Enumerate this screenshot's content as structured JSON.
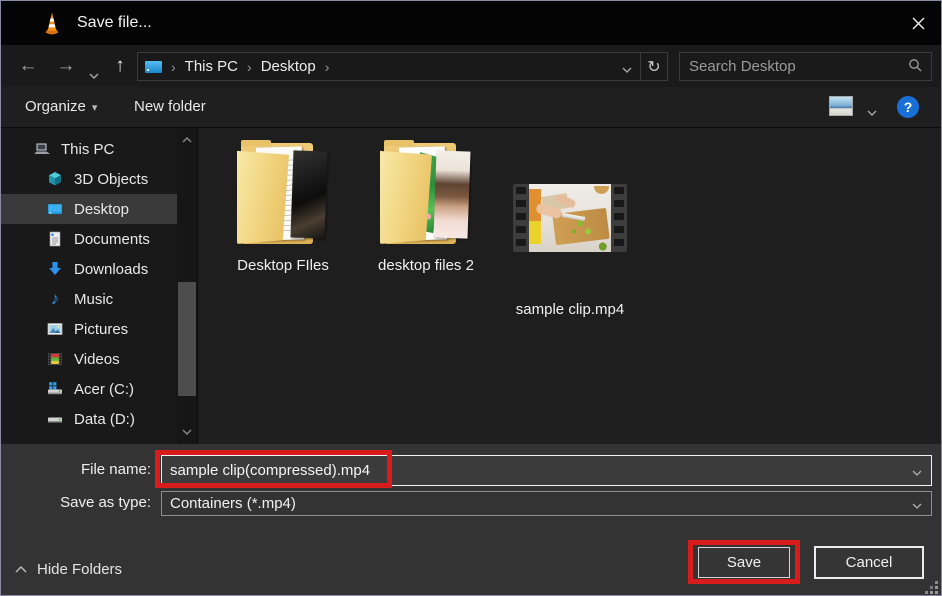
{
  "window": {
    "title": "Save file..."
  },
  "navbar": {
    "back_icon": "←",
    "forward_icon": "→",
    "up_icon": "↑",
    "refresh_icon": "↻",
    "breadcrumb": {
      "separator": "›",
      "items": [
        "This PC",
        "Desktop"
      ]
    },
    "search": {
      "placeholder": "Search Desktop"
    }
  },
  "toolbar": {
    "organize": "Organize",
    "organize_caret": "▾",
    "new_folder": "New folder",
    "help": "?"
  },
  "sidebar": {
    "items": [
      {
        "label": "This PC",
        "icon": "pc-icon",
        "selected": false
      },
      {
        "label": "3D Objects",
        "icon": "cube-icon",
        "selected": false
      },
      {
        "label": "Desktop",
        "icon": "monitor-icon",
        "selected": true
      },
      {
        "label": "Documents",
        "icon": "document-icon",
        "selected": false
      },
      {
        "label": "Downloads",
        "icon": "download-icon",
        "selected": false
      },
      {
        "label": "Music",
        "icon": "music-note-icon",
        "selected": false
      },
      {
        "label": "Pictures",
        "icon": "picture-icon",
        "selected": false
      },
      {
        "label": "Videos",
        "icon": "film-icon",
        "selected": false
      },
      {
        "label": "Acer (C:)",
        "icon": "drive-windows-icon",
        "selected": false
      },
      {
        "label": "Data (D:)",
        "icon": "drive-icon",
        "selected": false
      }
    ],
    "music_glyph": "♪"
  },
  "files": [
    {
      "label": "Desktop FIles",
      "type": "folder"
    },
    {
      "label": "desktop files 2",
      "type": "folder"
    },
    {
      "label": "sample clip.mp4",
      "type": "video"
    }
  ],
  "form": {
    "file_name_label": "File name:",
    "file_name_value": "sample clip(compressed).mp4",
    "save_as_type_label": "Save as type:",
    "save_as_type_value": "Containers (*.mp4)",
    "save": "Save",
    "cancel": "Cancel",
    "hide_folders": "Hide Folders"
  },
  "annotations": {
    "color": "#d81c1c",
    "highlighted": [
      "file-name-input",
      "save-button"
    ]
  },
  "colors": {
    "help_blue": "#1a6fd6",
    "folder_yellow": "#eecb78",
    "sidebar_selection": "#3a3a3a",
    "titlebar": "#040404",
    "bottom_panel": "#333333"
  }
}
